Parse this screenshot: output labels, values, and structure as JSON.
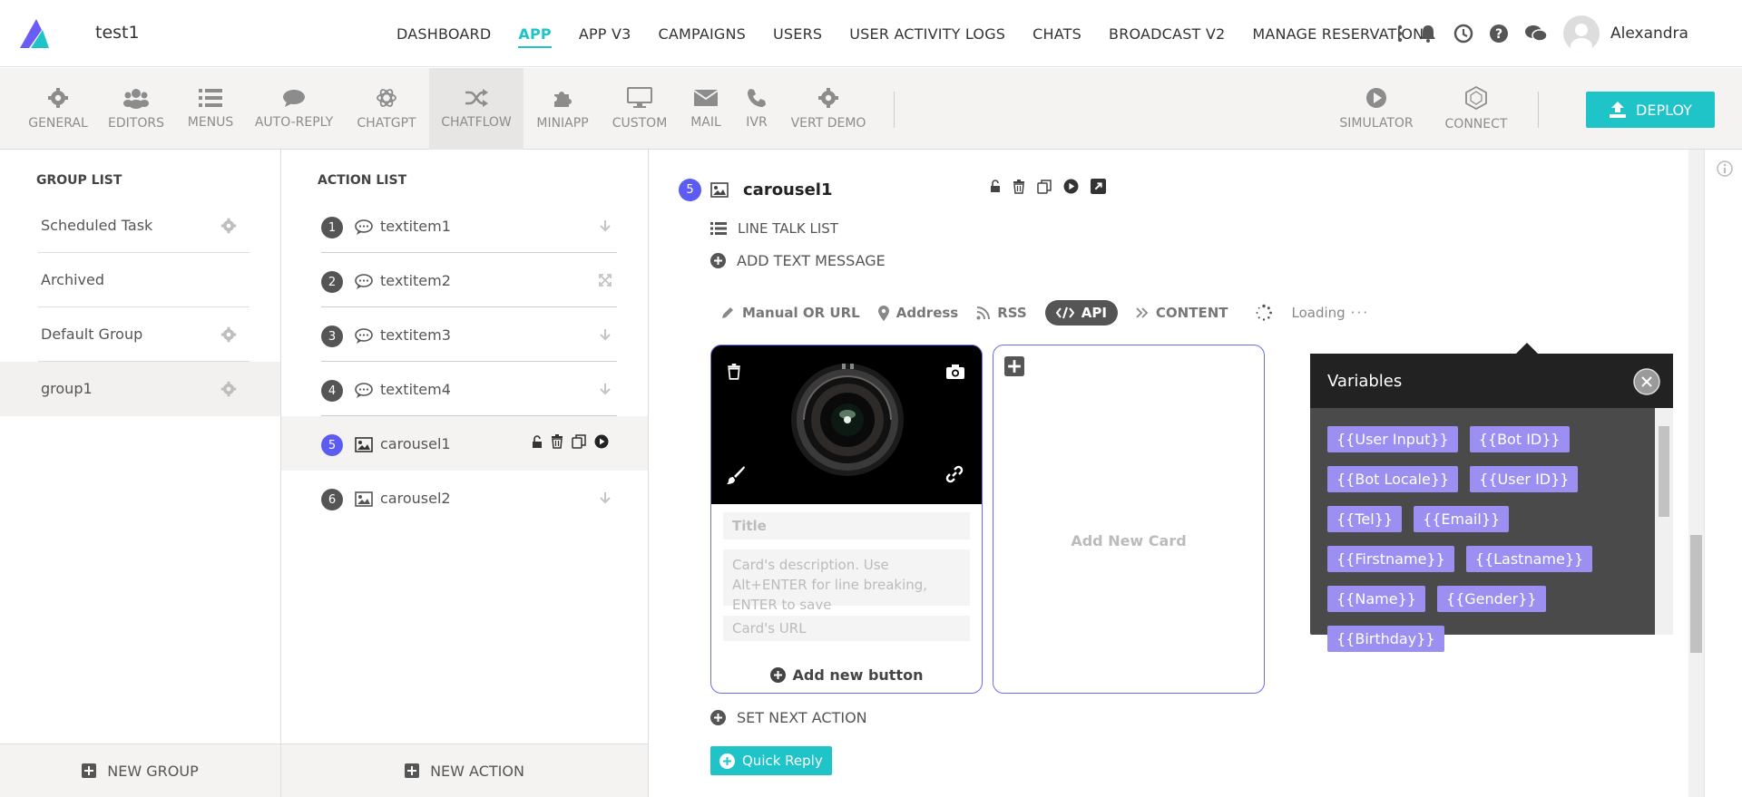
{
  "app": {
    "name": "test1"
  },
  "topnav": {
    "items": [
      "DASHBOARD",
      "APP",
      "APP V3",
      "CAMPAIGNS",
      "USERS",
      "USER ACTIVITY LOGS",
      "CHATS",
      "BROADCAST V2",
      "MANAGE RESERVATIONS"
    ],
    "active": "APP"
  },
  "user": {
    "name": "Alexandra"
  },
  "toolbar": {
    "items": [
      "GENERAL",
      "EDITORS",
      "MENUS",
      "AUTO-REPLY",
      "CHATGPT",
      "CHATFLOW",
      "MINIAPP",
      "CUSTOM",
      "MAIL",
      "IVR",
      "VERT DEMO"
    ],
    "active": "CHATFLOW",
    "simulator": "SIMULATOR",
    "connect": "CONNECT",
    "deploy": "DEPLOY"
  },
  "groups": {
    "title": "GROUP LIST",
    "items": [
      "Scheduled Task",
      "Archived",
      "Default Group",
      "group1"
    ],
    "selected": "group1",
    "new_label": "NEW GROUP"
  },
  "actions": {
    "title": "ACTION LIST",
    "items": [
      {
        "num": "1",
        "label": "textitem1"
      },
      {
        "num": "2",
        "label": "textitem2"
      },
      {
        "num": "3",
        "label": "textitem3"
      },
      {
        "num": "4",
        "label": "textitem4"
      },
      {
        "num": "5",
        "label": "carousel1"
      },
      {
        "num": "6",
        "label": "carousel2"
      }
    ],
    "selected": "carousel1",
    "new_label": "NEW ACTION"
  },
  "editor": {
    "num": "5",
    "title": "carousel1",
    "line_talk_list": "LINE TALK LIST",
    "add_text_message": "ADD TEXT MESSAGE",
    "tabs": [
      "Manual OR URL",
      "Address",
      "RSS",
      "API",
      "CONTENT"
    ],
    "active_tab": "API",
    "loading": "Loading",
    "card": {
      "title_placeholder": "Title",
      "description_placeholder": "Card's description. Use Alt+ENTER for line breaking, ENTER to save",
      "url_placeholder": "Card's URL",
      "add_button": "Add new button"
    },
    "add_new_card": "Add New Card",
    "set_next_action": "SET NEXT ACTION",
    "quick_reply": "Quick Reply"
  },
  "variables": {
    "title": "Variables",
    "items": [
      "{{User Input}}",
      "{{Bot ID}}",
      "{{Bot Locale}}",
      "{{User ID}}",
      "{{Tel}}",
      "{{Email}}",
      "{{Firstname}}",
      "{{Lastname}}",
      "{{Name}}",
      "{{Gender}}",
      "{{Birthday}}"
    ]
  },
  "colors": {
    "accent": "#1fc4c8",
    "purple": "#5c5cf2",
    "chip": "#9b8ff2"
  }
}
